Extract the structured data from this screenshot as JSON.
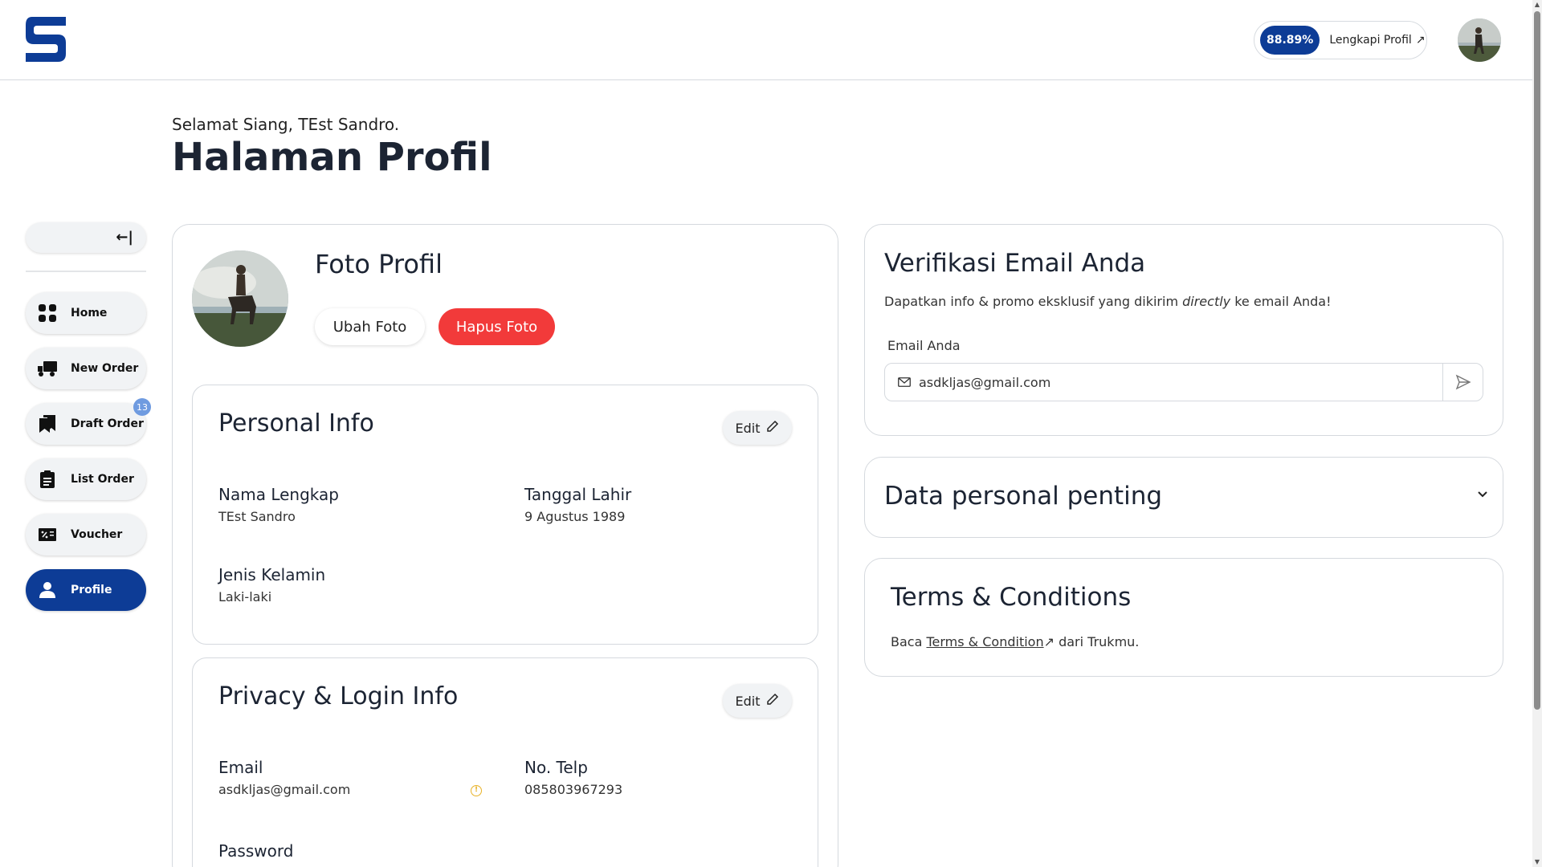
{
  "header": {
    "profile_percent": "88.89%",
    "profile_cta": "Lengkapi Profil",
    "cta_arrow": "↗"
  },
  "greeting": "Selamat Siang, TEst Sandro.",
  "page_title": "Halaman Profil",
  "sidebar": {
    "collapse_icon": "←|",
    "items": [
      {
        "label": "Home",
        "icon": "grid-icon"
      },
      {
        "label": "New Order",
        "icon": "truck-icon"
      },
      {
        "label": "Draft Order",
        "icon": "bookmark-icon",
        "badge": "13"
      },
      {
        "label": "List Order",
        "icon": "clipboard-icon"
      },
      {
        "label": "Voucher",
        "icon": "voucher-icon"
      },
      {
        "label": "Profile",
        "icon": "user-icon",
        "active": true
      }
    ]
  },
  "photo": {
    "title": "Foto Profil",
    "change_label": "Ubah Foto",
    "delete_label": "Hapus Foto"
  },
  "personal_info": {
    "title": "Personal Info",
    "edit_label": "Edit",
    "fields": {
      "full_name_label": "Nama Lengkap",
      "full_name_value": "TEst Sandro",
      "birth_label": "Tanggal Lahir",
      "birth_value": "9 Agustus 1989",
      "gender_label": "Jenis Kelamin",
      "gender_value": "Laki-laki"
    }
  },
  "privacy_info": {
    "title": "Privacy & Login Info",
    "edit_label": "Edit",
    "fields": {
      "email_label": "Email",
      "email_value": "asdkljas@gmail.com",
      "phone_label": "No. Telp",
      "phone_value": "085803967293",
      "password_label": "Password"
    }
  },
  "email_verify": {
    "title": "Verifikasi Email Anda",
    "desc_before": "Dapatkan info & promo eksklusif yang dikirim ",
    "desc_italic": "directly",
    "desc_after": " ke email Anda!",
    "input_label": "Email Anda",
    "input_value": "asdkljas@gmail.com"
  },
  "personal_data": {
    "title": "Data personal penting"
  },
  "terms": {
    "title": "Terms & Conditions",
    "before": "Baca ",
    "link": "Terms & Condition",
    "arrow": "↗",
    "after": " dari Trukmu."
  },
  "colors": {
    "brand_blue": "#0d3c96",
    "danger_red": "#f23a3a",
    "badge_blue": "#6f9be0"
  }
}
